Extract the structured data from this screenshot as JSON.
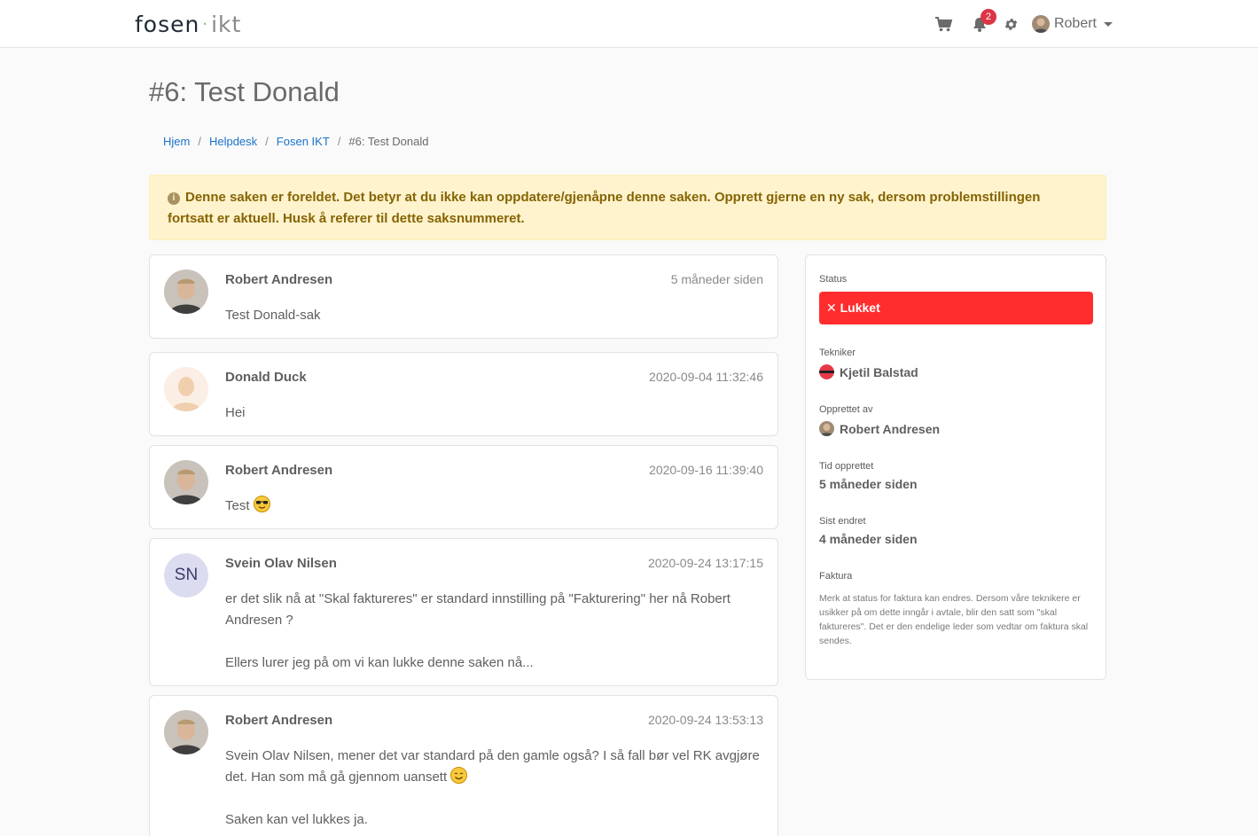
{
  "navbar": {
    "logo_main": "fosen",
    "logo_dot": "·",
    "logo_tail": "ikt",
    "notification_count": "2",
    "user_name": "Robert"
  },
  "page": {
    "title": "#6: Test Donald"
  },
  "breadcrumb": {
    "items": [
      "Hjem",
      "Helpdesk",
      "Fosen IKT"
    ],
    "current": "#6: Test Donald"
  },
  "alert": {
    "icon": "i",
    "text": "Denne saken er foreldet. Det betyr at du ikke kan oppdatere/gjenåpne denne saken. Opprett gjerne en ny sak, dersom problemstillingen fortsatt er aktuell. Husk å referer til dette saksnummeret."
  },
  "comments": [
    {
      "author": "Robert Andresen",
      "time": "5 måneder siden",
      "body": [
        "Test Donald-sak"
      ]
    },
    {
      "author": "Donald Duck",
      "time": "2020-09-04 11:32:46",
      "body": [
        "Hei"
      ]
    },
    {
      "author": "Robert Andresen",
      "time": "2020-09-16 11:39:40",
      "body": [
        "Test"
      ]
    },
    {
      "author": "Svein Olav Nilsen",
      "initials": "SN",
      "time": "2020-09-24 13:17:15",
      "body": [
        "er det slik nå at \"Skal faktureres\" er standard innstilling på \"Fakturering\" her nå Robert Andresen  ?",
        "Ellers lurer jeg på om vi kan lukke denne saken nå..."
      ]
    },
    {
      "author": "Robert Andresen",
      "time": "2020-09-24 13:53:13",
      "body": [
        "Svein Olav Nilsen, mener det var standard på den gamle også? I så fall bør vel RK avgjøre det. Han som må gå gjennom uansett",
        "Saken kan vel lukkes ja."
      ]
    }
  ],
  "side": {
    "status_label": "Status",
    "status_value": "Lukket",
    "status_mark": "✕",
    "tekniker_label": "Tekniker",
    "tekniker_value": "Kjetil Balstad",
    "opprettet_av_label": "Opprettet av",
    "opprettet_av_value": "Robert Andresen",
    "tid_label": "Tid opprettet",
    "tid_value": "5 måneder siden",
    "sist_label": "Sist endret",
    "sist_value": "4 måneder siden",
    "faktura_label": "Faktura",
    "faktura_note": "Merk at status for faktura kan endres. Dersom våre teknikere er usikker på om dette inngår i avtale, blir den satt som \"skal faktureres\". Det er den endelige leder som vedtar om faktura skal sendes."
  },
  "colors": {
    "status_closed": "#ff2d2d",
    "link": "#1a73c8",
    "alert_bg": "#fff3cd",
    "badge": "#dc3545"
  },
  "icons": [
    "cart-icon",
    "bell-icon",
    "gear-icon",
    "info-icon",
    "close-icon",
    "sunglasses-emoji",
    "smile-emoji"
  ]
}
